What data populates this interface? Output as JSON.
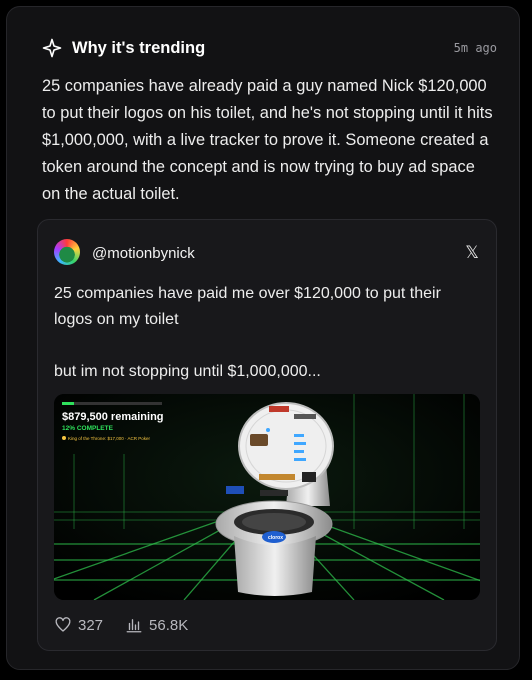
{
  "card": {
    "title": "Why it's trending",
    "time": "5m ago",
    "summary": "25 companies have already paid a guy named Nick $120,000 to put their logos on his toilet, and he's not stopping until it hits $1,000,000, with a live tracker to prove it. Someone created a token around the concept and is now trying to buy ad space on the actual toilet."
  },
  "tweet": {
    "handle": "@motionbynick",
    "text": "25 companies have paid me over $120,000 to put their logos on my toilet\n\nbut im not stopping until $1,000,000...",
    "media": {
      "remaining": "$879,500 remaining",
      "complete": "12% COMPLETE",
      "king": "King of the Throne: $17,000 · ACR Poker",
      "progress_fraction": 0.12
    },
    "likes": "327",
    "views": "56.8K"
  },
  "icons": {
    "sparkle": "sparkle-icon",
    "close": "x-close-icon",
    "heart": "heart-icon",
    "views": "bar-chart-icon"
  }
}
